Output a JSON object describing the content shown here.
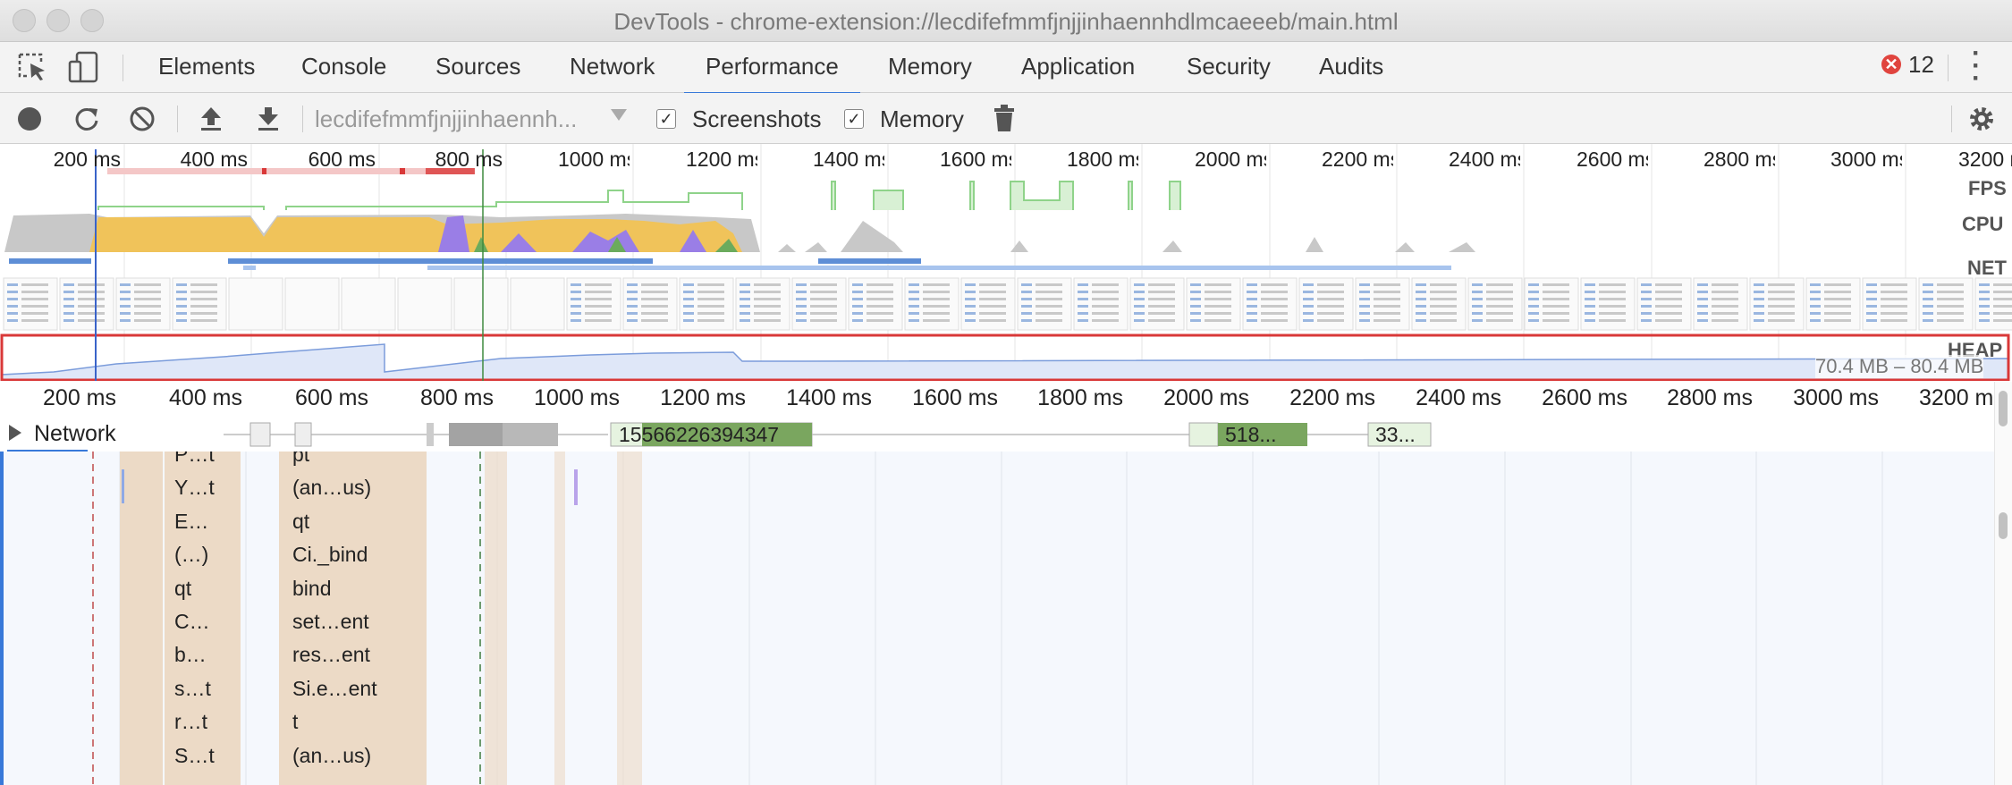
{
  "window": {
    "title": "DevTools - chrome-extension://lecdifefmmfjnjjinhaennhdlmcaeeeb/main.html"
  },
  "tabs": [
    {
      "label": "Elements"
    },
    {
      "label": "Console"
    },
    {
      "label": "Sources"
    },
    {
      "label": "Network"
    },
    {
      "label": "Performance",
      "active": true
    },
    {
      "label": "Memory"
    },
    {
      "label": "Application"
    },
    {
      "label": "Security"
    },
    {
      "label": "Audits"
    }
  ],
  "error_count": "12",
  "toolbar": {
    "profile_select": "lecdifefmmfjnjjinhaennh...",
    "screenshots_label": "Screenshots",
    "screenshots_checked": true,
    "memory_label": "Memory",
    "memory_checked": true
  },
  "overview": {
    "ruler_ticks": [
      "200 ms",
      "400 ms",
      "600 ms",
      "800 ms",
      "1000 ms",
      "1200 ms",
      "1400 ms",
      "1600 ms",
      "1800 ms",
      "2000 ms",
      "2200 ms",
      "2400 ms",
      "2600 ms",
      "2800 ms",
      "3000 ms",
      "3200 ms"
    ],
    "tracks": {
      "fps": "FPS",
      "cpu": "CPU",
      "net": "NET",
      "heap": "HEAP"
    },
    "heap_range": "70.4 MB – 80.4 MB"
  },
  "timeline": {
    "ruler_ticks": [
      "200 ms",
      "400 ms",
      "600 ms",
      "800 ms",
      "1000 ms",
      "1200 ms",
      "1400 ms",
      "1600 ms",
      "1800 ms",
      "2000 ms",
      "2200 ms",
      "2400 ms",
      "2600 ms",
      "2800 ms",
      "3000 ms",
      "3200 ms"
    ],
    "network_label": "Network",
    "network_requests": [
      "1556622639434​7",
      "518...",
      "33..."
    ],
    "flame_col1": [
      "P…t",
      "Y…t",
      "E…",
      "(…)",
      "qt",
      "C…",
      "b…",
      "s…t",
      "r…t",
      "S…t"
    ],
    "flame_col2": [
      "pt",
      "(an…us)",
      "qt",
      "Ci._bind",
      "bind",
      "set…ent",
      "res…ent",
      "Si.e…ent",
      "t",
      "(an…us)"
    ]
  },
  "colors": {
    "accent": "#3879d9",
    "heap_border": "#d93838",
    "cpu_scripting": "#f0c35a",
    "cpu_rendering": "#9a7ee6",
    "cpu_painting": "#6bab5d",
    "fps_green": "#8fd38a",
    "net_blue": "#5e8ed6",
    "flame_tan": "#ecdac6",
    "network_green": "#7aa65f"
  },
  "icons": [
    "inspect-icon",
    "device-toggle-icon",
    "record-icon",
    "reload-icon",
    "clear-icon",
    "upload-icon",
    "download-icon",
    "trash-icon",
    "settings-icon",
    "more-icon",
    "error-icon"
  ]
}
